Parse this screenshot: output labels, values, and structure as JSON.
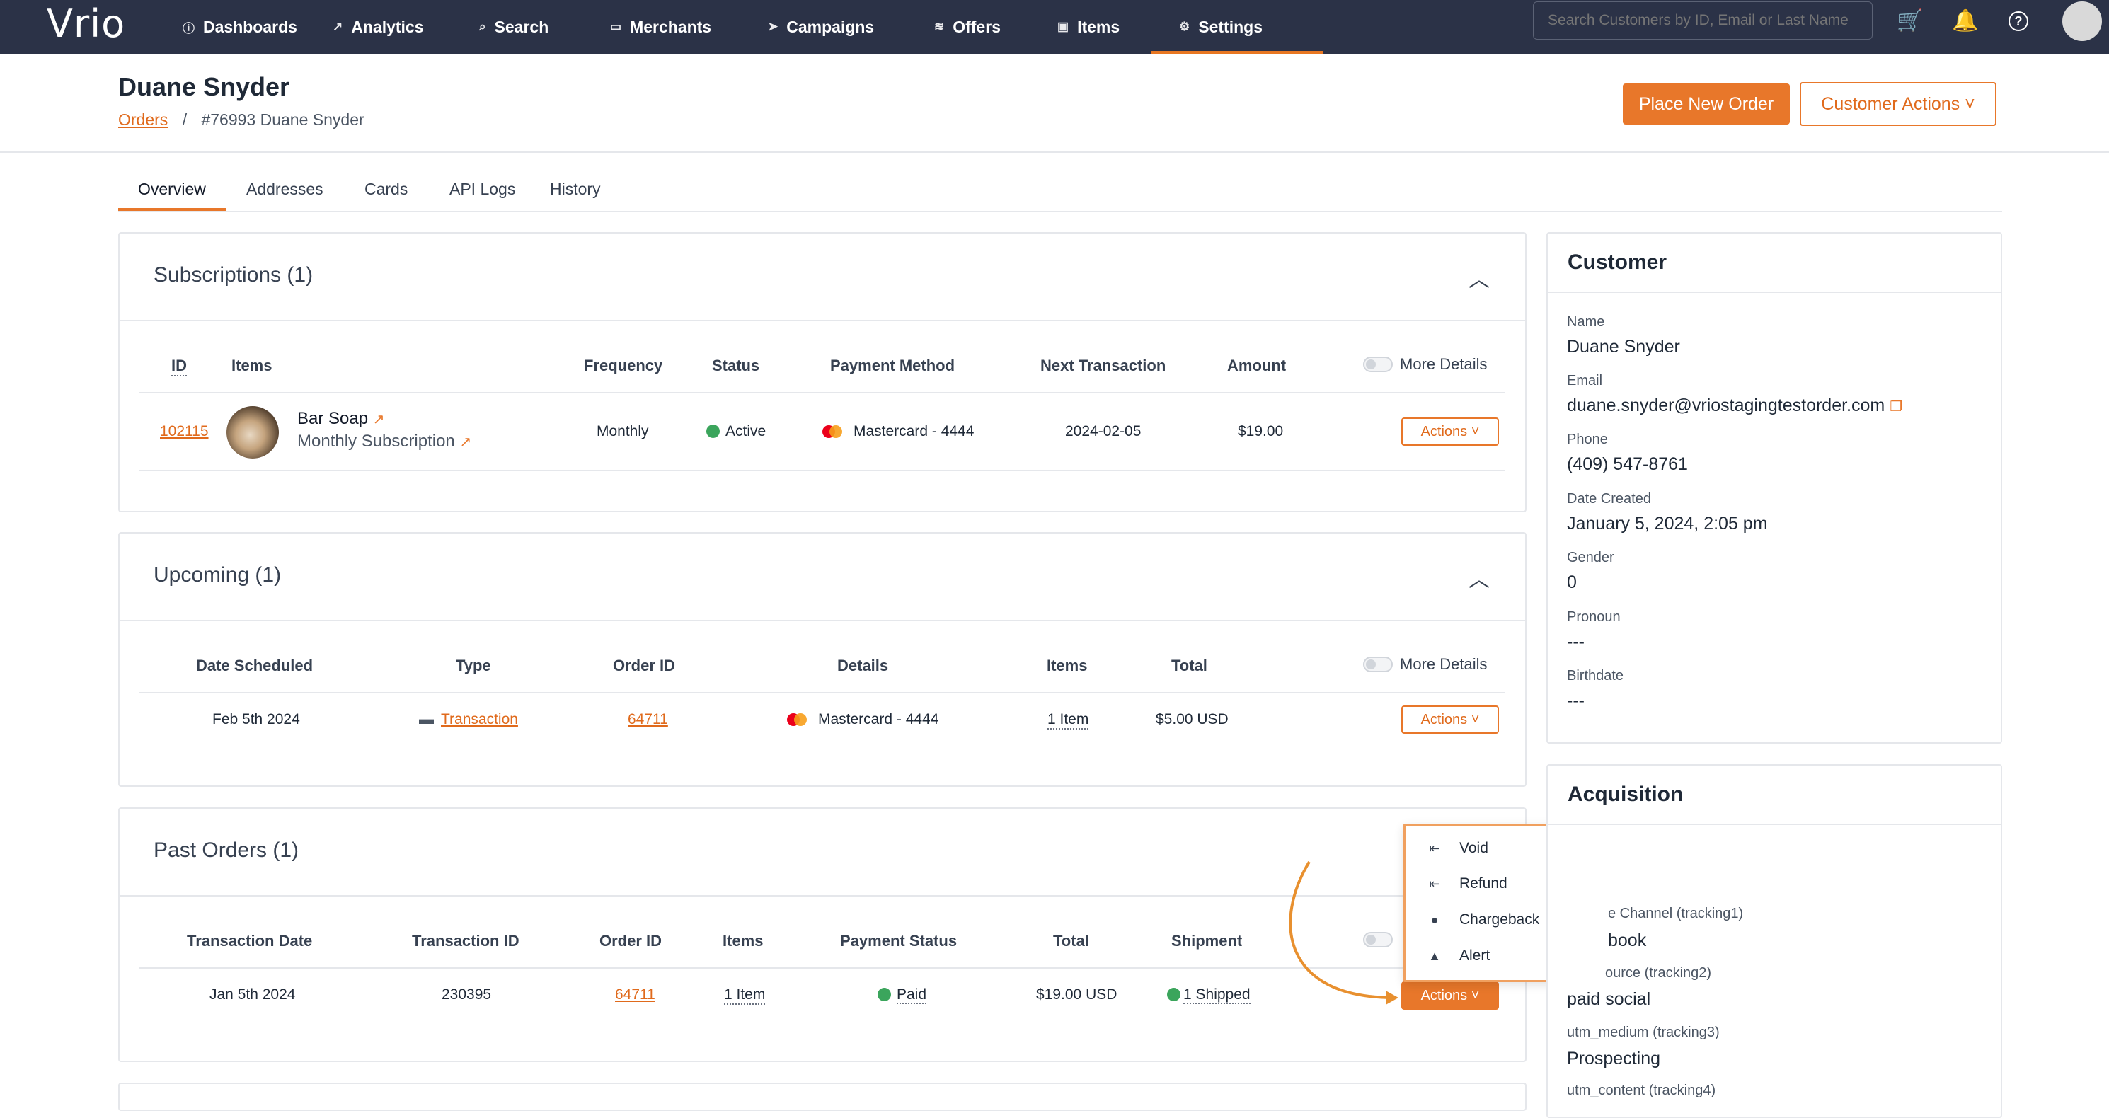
{
  "topbar": {
    "logo": "Vrio",
    "nav": [
      {
        "label": "Dashboards",
        "icon": "ⓘ"
      },
      {
        "label": "Analytics",
        "icon": "↗"
      },
      {
        "label": "Search",
        "icon": "⌕"
      },
      {
        "label": "Merchants",
        "icon": "▭"
      },
      {
        "label": "Campaigns",
        "icon": "➤"
      },
      {
        "label": "Offers",
        "icon": "≋"
      },
      {
        "label": "Items",
        "icon": "▣"
      },
      {
        "label": "Settings",
        "icon": "⚙"
      }
    ],
    "search_placeholder": "Search Customers by ID, Email or Last Name",
    "cart_icon": "🛒",
    "bell_icon": "🔔",
    "help_icon": "?"
  },
  "header": {
    "title": "Duane Snyder",
    "breadcrumb_link": "Orders",
    "breadcrumb_sep": "/",
    "breadcrumb_current": "#76993 Duane Snyder",
    "place_order": "Place New Order",
    "customer_actions": "Customer Actions ˅"
  },
  "tabs": [
    "Overview",
    "Addresses",
    "Cards",
    "API Logs",
    "History"
  ],
  "subscriptions": {
    "title": "Subscriptions (1)",
    "headers": [
      "ID",
      "Items",
      "Frequency",
      "Status",
      "Payment Method",
      "Next Transaction",
      "Amount"
    ],
    "more_details": "More Details",
    "row": {
      "id": "102115",
      "item_name": "Bar Soap",
      "item_sub": "Monthly Subscription",
      "frequency": "Monthly",
      "status": "Active",
      "payment": "Mastercard - 4444",
      "next": "2024-02-05",
      "amount": "$19.00",
      "actions": "Actions ˅"
    }
  },
  "upcoming": {
    "title": "Upcoming (1)",
    "headers": [
      "Date Scheduled",
      "Type",
      "Order ID",
      "Details",
      "Items",
      "Total"
    ],
    "more_details": "More Details",
    "row": {
      "date": "Feb 5th 2024",
      "type": "Transaction",
      "order_id": "64711",
      "details": "Mastercard - 4444",
      "items": "1 Item",
      "total": "$5.00 USD",
      "actions": "Actions ˅"
    }
  },
  "past_orders": {
    "title": "Past Orders (1)",
    "headers": [
      "Transaction Date",
      "Transaction ID",
      "Order ID",
      "Items",
      "Payment Status",
      "Total",
      "Shipment"
    ],
    "row": {
      "date": "Jan 5th 2024",
      "txn_id": "230395",
      "order_id": "64711",
      "items": "1 Item",
      "payment_status": "Paid",
      "total": "$19.00 USD",
      "shipment": "1 Shipped",
      "actions": "Actions ˅"
    }
  },
  "actions_menu": [
    {
      "label": "Void",
      "icon": "⇤"
    },
    {
      "label": "Refund",
      "icon": "⇤"
    },
    {
      "label": "Chargeback",
      "icon": "●"
    },
    {
      "label": "Alert",
      "icon": "▲"
    }
  ],
  "customer": {
    "title": "Customer",
    "name_label": "Name",
    "name": "Duane Snyder",
    "email_label": "Email",
    "email": "duane.snyder@vriostagingtestorder.com",
    "phone_label": "Phone",
    "phone": "(409) 547-8761",
    "created_label": "Date Created",
    "created": "January 5, 2024, 2:05 pm",
    "gender_label": "Gender",
    "gender": "0",
    "pronoun_label": "Pronoun",
    "pronoun": "---",
    "birthdate_label": "Birthdate",
    "birthdate": "---"
  },
  "acquisition": {
    "title": "Acquisition",
    "channel_label": "e Channel (tracking1)",
    "channel": "book",
    "source_label": "ource (tracking2)",
    "source": "paid social",
    "medium_label": "utm_medium (tracking3)",
    "medium": "Prospecting",
    "content_label": "utm_content (tracking4)"
  },
  "colors": {
    "accent": "#e8772a",
    "topbar": "#2b3247",
    "status_green": "#3ba55c"
  }
}
